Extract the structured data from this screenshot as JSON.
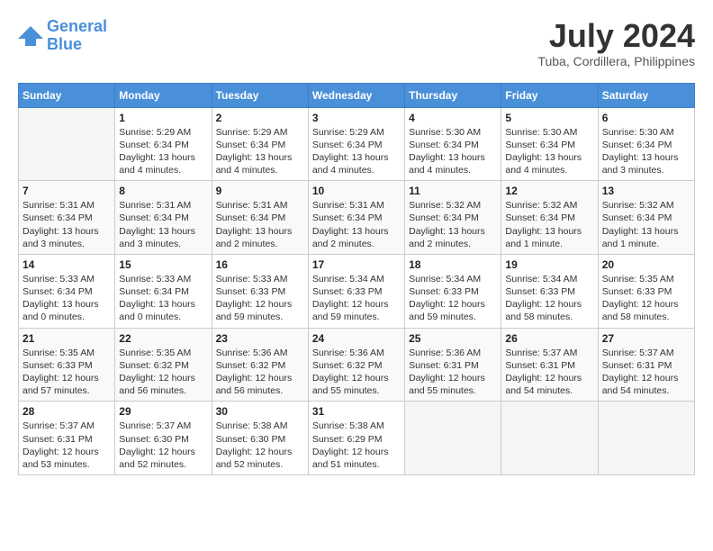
{
  "header": {
    "logo_line1": "General",
    "logo_line2": "Blue",
    "month_year": "July 2024",
    "location": "Tuba, Cordillera, Philippines"
  },
  "weekdays": [
    "Sunday",
    "Monday",
    "Tuesday",
    "Wednesday",
    "Thursday",
    "Friday",
    "Saturday"
  ],
  "weeks": [
    [
      {
        "day": "",
        "info": ""
      },
      {
        "day": "1",
        "info": "Sunrise: 5:29 AM\nSunset: 6:34 PM\nDaylight: 13 hours\nand 4 minutes."
      },
      {
        "day": "2",
        "info": "Sunrise: 5:29 AM\nSunset: 6:34 PM\nDaylight: 13 hours\nand 4 minutes."
      },
      {
        "day": "3",
        "info": "Sunrise: 5:29 AM\nSunset: 6:34 PM\nDaylight: 13 hours\nand 4 minutes."
      },
      {
        "day": "4",
        "info": "Sunrise: 5:30 AM\nSunset: 6:34 PM\nDaylight: 13 hours\nand 4 minutes."
      },
      {
        "day": "5",
        "info": "Sunrise: 5:30 AM\nSunset: 6:34 PM\nDaylight: 13 hours\nand 4 minutes."
      },
      {
        "day": "6",
        "info": "Sunrise: 5:30 AM\nSunset: 6:34 PM\nDaylight: 13 hours\nand 3 minutes."
      }
    ],
    [
      {
        "day": "7",
        "info": "Sunrise: 5:31 AM\nSunset: 6:34 PM\nDaylight: 13 hours\nand 3 minutes."
      },
      {
        "day": "8",
        "info": "Sunrise: 5:31 AM\nSunset: 6:34 PM\nDaylight: 13 hours\nand 3 minutes."
      },
      {
        "day": "9",
        "info": "Sunrise: 5:31 AM\nSunset: 6:34 PM\nDaylight: 13 hours\nand 2 minutes."
      },
      {
        "day": "10",
        "info": "Sunrise: 5:31 AM\nSunset: 6:34 PM\nDaylight: 13 hours\nand 2 minutes."
      },
      {
        "day": "11",
        "info": "Sunrise: 5:32 AM\nSunset: 6:34 PM\nDaylight: 13 hours\nand 2 minutes."
      },
      {
        "day": "12",
        "info": "Sunrise: 5:32 AM\nSunset: 6:34 PM\nDaylight: 13 hours\nand 1 minute."
      },
      {
        "day": "13",
        "info": "Sunrise: 5:32 AM\nSunset: 6:34 PM\nDaylight: 13 hours\nand 1 minute."
      }
    ],
    [
      {
        "day": "14",
        "info": "Sunrise: 5:33 AM\nSunset: 6:34 PM\nDaylight: 13 hours\nand 0 minutes."
      },
      {
        "day": "15",
        "info": "Sunrise: 5:33 AM\nSunset: 6:34 PM\nDaylight: 13 hours\nand 0 minutes."
      },
      {
        "day": "16",
        "info": "Sunrise: 5:33 AM\nSunset: 6:33 PM\nDaylight: 12 hours\nand 59 minutes."
      },
      {
        "day": "17",
        "info": "Sunrise: 5:34 AM\nSunset: 6:33 PM\nDaylight: 12 hours\nand 59 minutes."
      },
      {
        "day": "18",
        "info": "Sunrise: 5:34 AM\nSunset: 6:33 PM\nDaylight: 12 hours\nand 59 minutes."
      },
      {
        "day": "19",
        "info": "Sunrise: 5:34 AM\nSunset: 6:33 PM\nDaylight: 12 hours\nand 58 minutes."
      },
      {
        "day": "20",
        "info": "Sunrise: 5:35 AM\nSunset: 6:33 PM\nDaylight: 12 hours\nand 58 minutes."
      }
    ],
    [
      {
        "day": "21",
        "info": "Sunrise: 5:35 AM\nSunset: 6:33 PM\nDaylight: 12 hours\nand 57 minutes."
      },
      {
        "day": "22",
        "info": "Sunrise: 5:35 AM\nSunset: 6:32 PM\nDaylight: 12 hours\nand 56 minutes."
      },
      {
        "day": "23",
        "info": "Sunrise: 5:36 AM\nSunset: 6:32 PM\nDaylight: 12 hours\nand 56 minutes."
      },
      {
        "day": "24",
        "info": "Sunrise: 5:36 AM\nSunset: 6:32 PM\nDaylight: 12 hours\nand 55 minutes."
      },
      {
        "day": "25",
        "info": "Sunrise: 5:36 AM\nSunset: 6:31 PM\nDaylight: 12 hours\nand 55 minutes."
      },
      {
        "day": "26",
        "info": "Sunrise: 5:37 AM\nSunset: 6:31 PM\nDaylight: 12 hours\nand 54 minutes."
      },
      {
        "day": "27",
        "info": "Sunrise: 5:37 AM\nSunset: 6:31 PM\nDaylight: 12 hours\nand 54 minutes."
      }
    ],
    [
      {
        "day": "28",
        "info": "Sunrise: 5:37 AM\nSunset: 6:31 PM\nDaylight: 12 hours\nand 53 minutes."
      },
      {
        "day": "29",
        "info": "Sunrise: 5:37 AM\nSunset: 6:30 PM\nDaylight: 12 hours\nand 52 minutes."
      },
      {
        "day": "30",
        "info": "Sunrise: 5:38 AM\nSunset: 6:30 PM\nDaylight: 12 hours\nand 52 minutes."
      },
      {
        "day": "31",
        "info": "Sunrise: 5:38 AM\nSunset: 6:29 PM\nDaylight: 12 hours\nand 51 minutes."
      },
      {
        "day": "",
        "info": ""
      },
      {
        "day": "",
        "info": ""
      },
      {
        "day": "",
        "info": ""
      }
    ]
  ]
}
